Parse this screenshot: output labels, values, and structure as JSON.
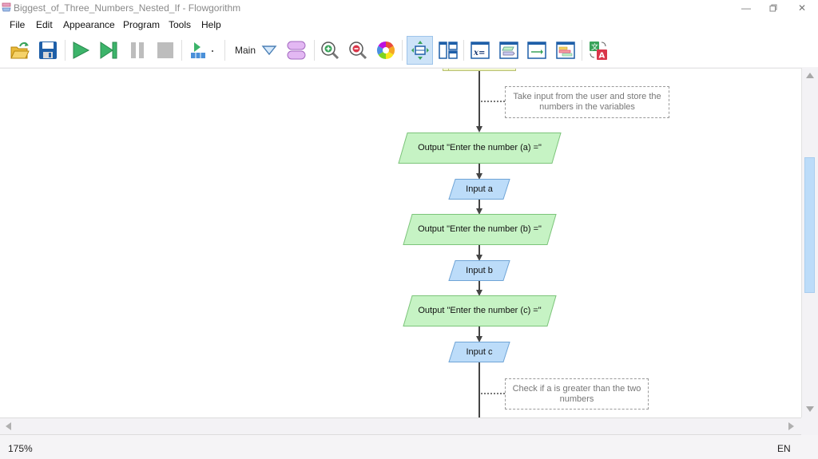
{
  "window": {
    "title": "Biggest_of_Three_Numbers_Nested_If - Flowgorithm",
    "app_icon": "flowgorithm-logo-icon",
    "controls": [
      "minimize",
      "restore",
      "close"
    ]
  },
  "menu": [
    "File",
    "Edit",
    "Appearance",
    "Program",
    "Tools",
    "Help"
  ],
  "toolbar": {
    "buttons": [
      {
        "name": "open",
        "icon": "open-folder-icon"
      },
      {
        "name": "save",
        "icon": "save-disk-icon"
      },
      {
        "name": "run",
        "icon": "play-icon"
      },
      {
        "name": "step",
        "icon": "step-icon"
      },
      {
        "name": "pause",
        "icon": "pause-icon"
      },
      {
        "name": "stop",
        "icon": "stop-icon"
      },
      {
        "name": "speed",
        "icon": "run-speed-icon"
      },
      {
        "name": "function-selector",
        "icon": "chevron-down-icon"
      },
      {
        "name": "add-function",
        "icon": "function-manager-icon"
      },
      {
        "name": "zoom-in",
        "icon": "zoom-in-icon"
      },
      {
        "name": "zoom-out",
        "icon": "zoom-out-icon"
      },
      {
        "name": "color-scheme",
        "icon": "color-wheel-icon"
      },
      {
        "name": "layout-view",
        "icon": "layout-icon",
        "active": true
      },
      {
        "name": "layout-panels",
        "icon": "panels-icon"
      },
      {
        "name": "variable-watch",
        "icon": "variable-watch-icon"
      },
      {
        "name": "source-code-viewer",
        "icon": "source-code-icon"
      },
      {
        "name": "console",
        "icon": "console-icon"
      },
      {
        "name": "chart",
        "icon": "chart-icon"
      },
      {
        "name": "translate",
        "icon": "translate-icon"
      }
    ],
    "function_label": "Main"
  },
  "flowchart": {
    "comments": [
      "Take input from the user and store the numbers in the variables",
      "Check if a is greater than the two numbers"
    ],
    "nodes": [
      {
        "type": "output",
        "text": "Output \"Enter the number (a) =\""
      },
      {
        "type": "input",
        "text": "Input a"
      },
      {
        "type": "output",
        "text": "Output \"Enter the number (b) =\""
      },
      {
        "type": "input",
        "text": "Input b"
      },
      {
        "type": "output",
        "text": "Output \"Enter the number (c) =\""
      },
      {
        "type": "input",
        "text": "Input c"
      }
    ],
    "colors": {
      "output_fill": "#c6f3c4",
      "output_stroke": "#7cc47a",
      "input_fill": "#bcdcf9",
      "input_stroke": "#6fa4d6",
      "declare_fill": "#f2f8c6"
    }
  },
  "statusbar": {
    "zoom": "175%",
    "language": "EN"
  }
}
